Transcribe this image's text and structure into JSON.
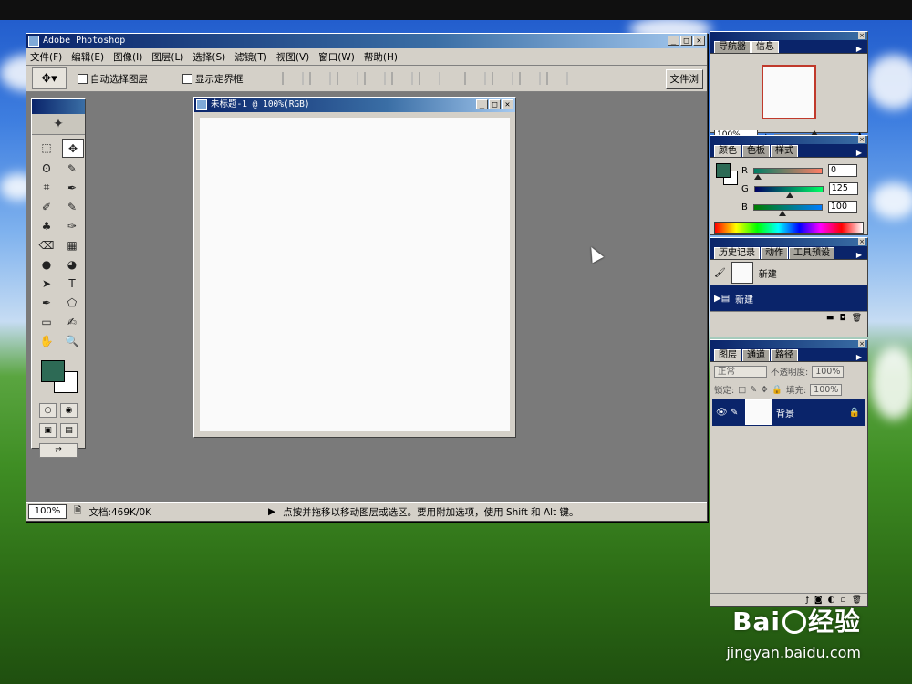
{
  "app": {
    "title": "Adobe Photoshop",
    "menu": [
      "文件(F)",
      "编辑(E)",
      "图像(I)",
      "图层(L)",
      "选择(S)",
      "滤镜(T)",
      "视图(V)",
      "窗口(W)",
      "帮助(H)"
    ],
    "options": {
      "auto_select_layer": "自动选择图层",
      "show_bounding_box": "显示定界框",
      "file_browser_btn": "文件浏"
    },
    "status": {
      "zoom": "100%",
      "doc_size": "文档:469K/0K",
      "hint": "点按并拖移以移动图层或选区。要用附加选项，使用 Shift 和 Alt 键。"
    },
    "window_buttons": [
      "_",
      "□",
      "✕"
    ]
  },
  "document": {
    "title": "未标题-1 @ 100%(RGB)"
  },
  "toolbox": {
    "logo": "✦",
    "tools": [
      "⬚",
      "✥",
      "ʘ",
      "✎",
      "⌗",
      "✒",
      "✐",
      "✎",
      "♣",
      "✑",
      "⌫",
      "▦",
      "●",
      "◕",
      "➤",
      "T",
      "✒",
      "⬠",
      "▭",
      "✍",
      "✋",
      "🔍"
    ]
  },
  "colors": {
    "foreground": "#2d6a55",
    "background": "#ffffff",
    "accent_title": "#0a246a"
  },
  "palettes": {
    "navigator": {
      "tabs": [
        "导航器",
        "信息"
      ],
      "zoom": "100%"
    },
    "color": {
      "tabs": [
        "颜色",
        "色板",
        "样式"
      ],
      "channels": [
        {
          "label": "R",
          "value": "0",
          "knob": 0.0,
          "grad": "linear-gradient(90deg,#007d64,#ff7d64)"
        },
        {
          "label": "G",
          "value": "125",
          "knob": 0.49,
          "grad": "linear-gradient(90deg,#000064,#00ff64)"
        },
        {
          "label": "B",
          "value": "100",
          "knob": 0.39,
          "grad": "linear-gradient(90deg,#007d00,#007dff)"
        }
      ]
    },
    "history": {
      "tabs": [
        "历史记录",
        "动作",
        "工具预设"
      ],
      "snapshot_label": "新建",
      "items": [
        "新建"
      ]
    },
    "layers": {
      "tabs": [
        "图层",
        "通道",
        "路径"
      ],
      "blend_mode": "正常",
      "opacity_label": "不透明度:",
      "opacity": "100%",
      "lock_label": "锁定:",
      "fill_label": "填充:",
      "fill": "100%",
      "layer_name": "背景"
    }
  },
  "watermark": {
    "brand": "Bai",
    "brand_cn": "经验",
    "url": "jingyan.baidu.com"
  }
}
